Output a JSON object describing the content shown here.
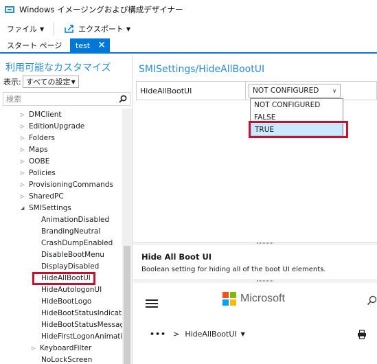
{
  "window": {
    "title": "Windows イメージングおよび構成デザイナー"
  },
  "menu": {
    "file_label": "ファイル",
    "export_label": "エクスポート"
  },
  "tabs": [
    {
      "label": "スタート ページ"
    },
    {
      "label": "test"
    }
  ],
  "left_panel": {
    "heading": "利用可能なカスタマイズ",
    "filter_label": "表示:",
    "filter_value": "すべての設定",
    "search_placeholder": "検索"
  },
  "tree": {
    "items": [
      {
        "label": "DMClient"
      },
      {
        "label": "EditionUpgrade"
      },
      {
        "label": "Folders"
      },
      {
        "label": "Maps"
      },
      {
        "label": "OOBE"
      },
      {
        "label": "Policies"
      },
      {
        "label": "ProvisioningCommands"
      },
      {
        "label": "SharedPC"
      },
      {
        "label": "SMISettings"
      }
    ],
    "children": [
      {
        "label": "AnimationDisabled"
      },
      {
        "label": "BrandingNeutral"
      },
      {
        "label": "CrashDumpEnabled"
      },
      {
        "label": "DisableBootMenu"
      },
      {
        "label": "DisplayDisabled"
      },
      {
        "label": "HideAllBootUI"
      },
      {
        "label": "HideAutologonUI"
      },
      {
        "label": "HideBootLogo"
      },
      {
        "label": "HideBootStatusIndicator"
      },
      {
        "label": "HideBootStatusMessage"
      },
      {
        "label": "HideFirstLogonAnimatio"
      }
    ],
    "after": [
      {
        "label": "KeyboardFilter"
      },
      {
        "label": "NoLockScreen"
      }
    ]
  },
  "right_panel": {
    "heading": "SMISettings/HideAllBootUI",
    "setting_name": "HideAllBootUI",
    "setting_value": "NOT CONFIGURED",
    "dropdown_options": [
      {
        "label": "NOT CONFIGURED"
      },
      {
        "label": "FALSE"
      },
      {
        "label": "TRUE"
      }
    ]
  },
  "description": {
    "title": "Hide All Boot UI",
    "body": "Boolean setting for hiding all of the boot UI elements."
  },
  "web": {
    "brand": "Microsoft",
    "crumb_dots": "•••",
    "crumb_sep": ">",
    "crumb_current": "HideAllBootUI"
  },
  "colors": {
    "accent": "#0078d7",
    "heading_blue": "#2a8ad4",
    "highlight_red": "#c8102e",
    "selected_bg": "#cce8ff",
    "ms_red": "#f25022",
    "ms_green": "#7fba00",
    "ms_blue": "#00a4ef",
    "ms_yellow": "#ffb900"
  },
  "icons": [
    "app-icon",
    "export-icon",
    "close-icon",
    "search-icon",
    "chevron-down-icon",
    "tree-expand-icon",
    "hamburger-icon",
    "microsoft-logo",
    "print-icon"
  ]
}
